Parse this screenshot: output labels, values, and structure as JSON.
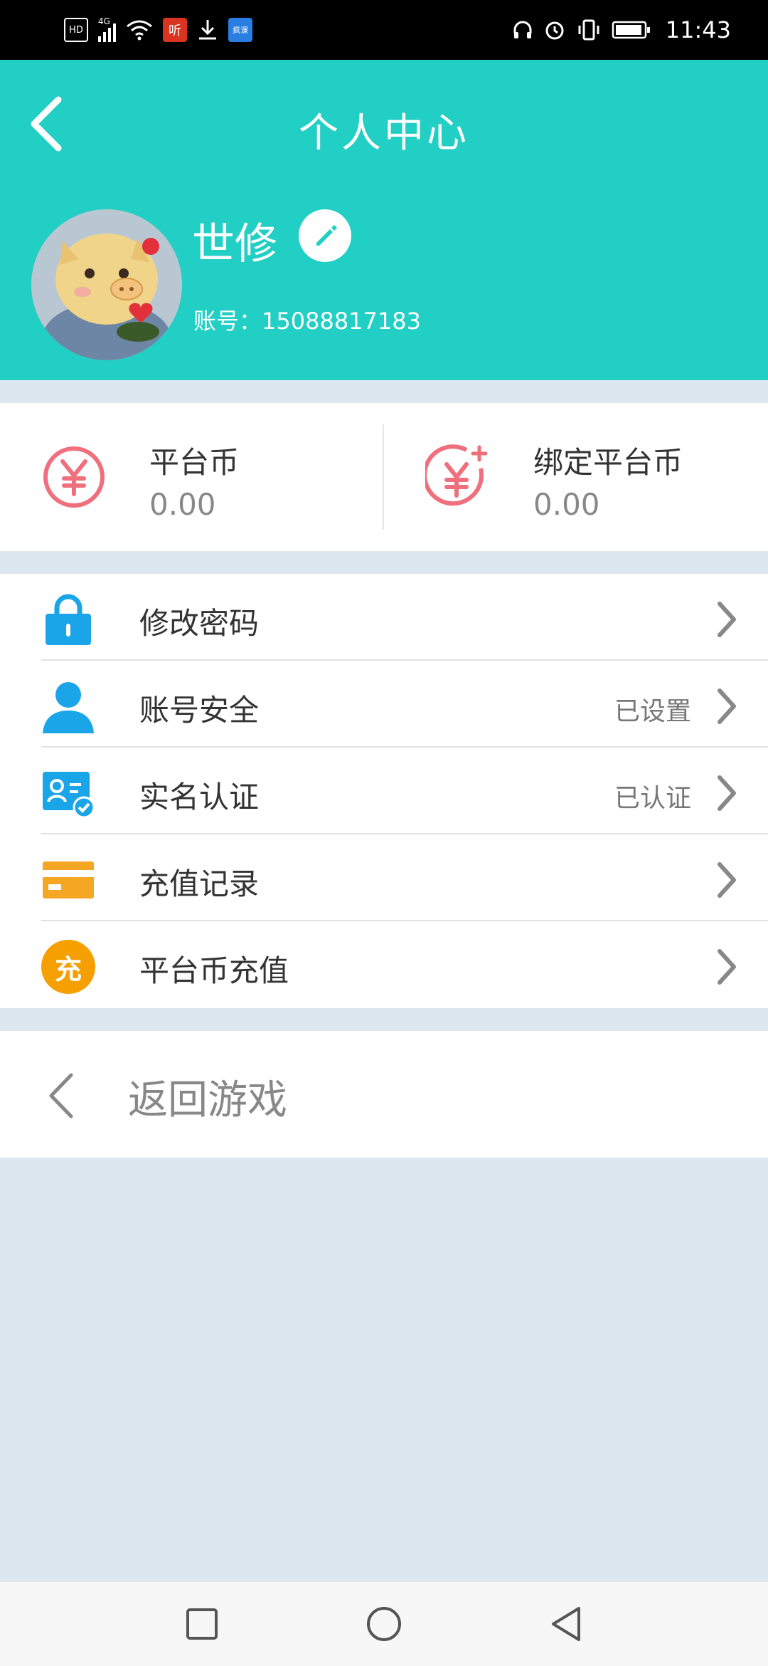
{
  "status_bar": {
    "time": "11:43",
    "left_icons": [
      "hd-icon",
      "signal-4g-icon",
      "wifi-icon",
      "app-ting-icon",
      "download-icon",
      "app-ke-icon"
    ],
    "right_icons": [
      "headphones-icon",
      "alarm-icon",
      "vibrate-icon",
      "battery-icon"
    ],
    "hd_label": "HD",
    "net_label": "4G",
    "app1_label": "听",
    "app2_label": "疯课"
  },
  "header": {
    "title": "个人中心",
    "username": "世修",
    "account_prefix": "账号：",
    "account": "15088817183",
    "bg_color": "#22cfc4"
  },
  "coins": [
    {
      "label": "平台币",
      "value": "0.00",
      "icon": "yuan-icon"
    },
    {
      "label": "绑定平台币",
      "value": "0.00",
      "icon": "yuan-plus-icon"
    }
  ],
  "menu": [
    {
      "label": "修改密码",
      "status": "",
      "icon": "lock-icon",
      "color": "#1aa5e8"
    },
    {
      "label": "账号安全",
      "status": "已设置",
      "icon": "user-icon",
      "color": "#1aa5e8"
    },
    {
      "label": "实名认证",
      "status": "已认证",
      "icon": "id-card-icon",
      "color": "#1aa5e8"
    },
    {
      "label": "充值记录",
      "status": "",
      "icon": "card-icon",
      "color": "#f5a623"
    },
    {
      "label": "平台币充值",
      "status": "",
      "icon": "recharge-icon",
      "color": "#f5a000",
      "icon_text": "充"
    }
  ],
  "return_label": "返回游戏",
  "nav": [
    "recent-apps-icon",
    "home-icon",
    "back-icon"
  ]
}
